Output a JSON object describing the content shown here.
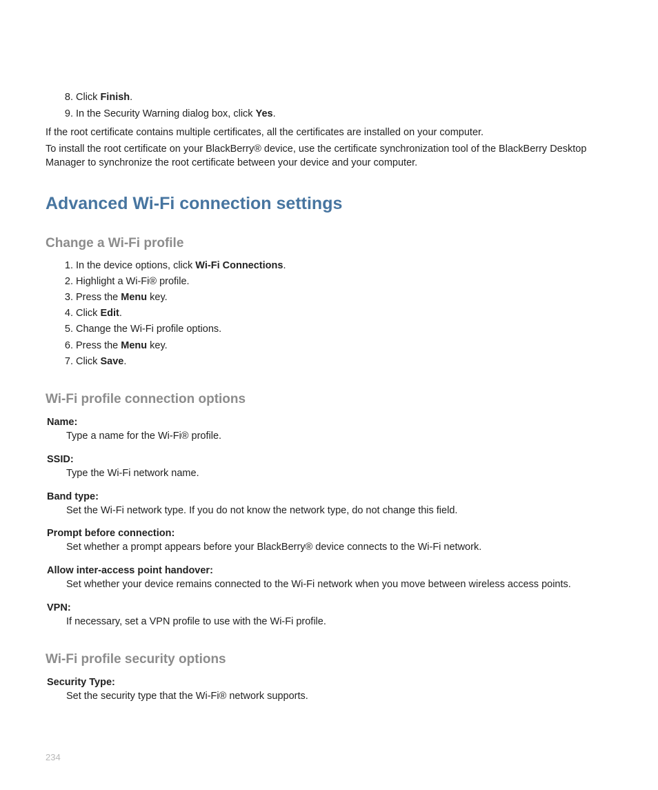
{
  "top_list": {
    "item8": {
      "pre": "Click ",
      "bold": "Finish",
      "post": "."
    },
    "item9": {
      "pre": "In the Security Warning dialog box, click ",
      "bold": "Yes",
      "post": "."
    }
  },
  "para1": "If the root certificate contains multiple certificates, all the certificates are installed on your computer.",
  "para2": "To install the root certificate on your BlackBerry® device, use the certificate synchronization tool of the BlackBerry Desktop Manager to synchronize the root certificate between your device and your computer.",
  "h1": "Advanced Wi-Fi connection settings",
  "h2_change": "Change a Wi-Fi profile",
  "change_list": {
    "s1": {
      "pre": "In the device options, click ",
      "bold": "Wi-Fi Connections",
      "post": "."
    },
    "s2": "Highlight a Wi-Fi® profile.",
    "s3": {
      "pre": "Press the ",
      "bold": "Menu",
      "post": " key."
    },
    "s4": {
      "pre": "Click ",
      "bold": "Edit",
      "post": "."
    },
    "s5": "Change the Wi-Fi profile options.",
    "s6": {
      "pre": "Press the ",
      "bold": "Menu",
      "post": " key."
    },
    "s7": {
      "pre": "Click ",
      "bold": "Save",
      "post": "."
    }
  },
  "h2_conn": "Wi-Fi profile connection options",
  "defs_conn": [
    {
      "term": "Name:",
      "desc": "Type a name for the Wi-Fi® profile."
    },
    {
      "term": "SSID:",
      "desc": "Type the Wi-Fi network name."
    },
    {
      "term": "Band type:",
      "desc": "Set the Wi-Fi network type. If you do not know the network type, do not change this field."
    },
    {
      "term": "Prompt before connection:",
      "desc": "Set whether a prompt appears before your BlackBerry® device connects to the Wi-Fi network."
    },
    {
      "term": "Allow inter-access point handover:",
      "desc": "Set whether your device remains connected to the Wi-Fi network when you move between wireless access points."
    },
    {
      "term": "VPN:",
      "desc": "If necessary, set a VPN profile to use with the Wi-Fi profile."
    }
  ],
  "h2_sec": "Wi-Fi profile security options",
  "defs_sec": [
    {
      "term": "Security Type:",
      "desc": "Set the security type that the Wi-Fi® network supports."
    }
  ],
  "page_number": "234"
}
